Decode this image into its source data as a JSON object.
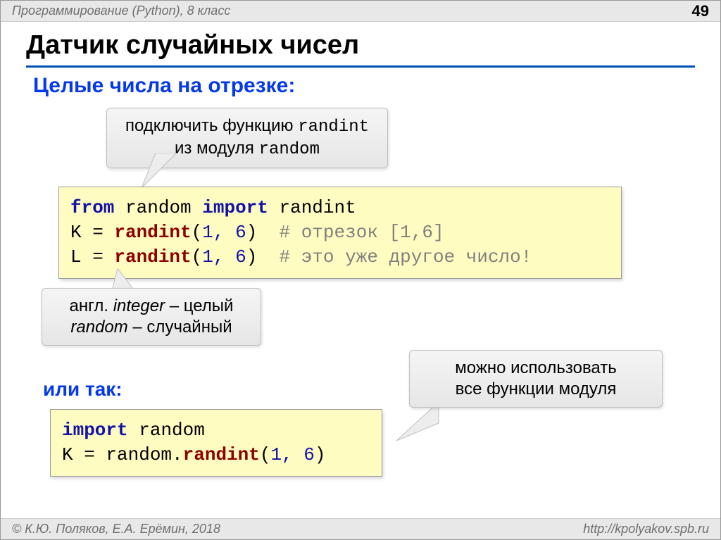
{
  "header": {
    "course": "Программирование (Python), 8 класс",
    "page": "49"
  },
  "title": "Датчик случайных чисел",
  "subtitle": "Целые числа на отрезке:",
  "bubble1": {
    "line1_pre": "подключить функцию ",
    "line1_mono": "randint",
    "line2_pre": "из модуля ",
    "line2_mono": "random"
  },
  "code1": {
    "l1_from": "from",
    "l1_mod": "random",
    "l1_import": "import",
    "l1_name": "randint",
    "l2_var": "K = ",
    "l2_fn": "randint",
    "l2_args_open": "(",
    "l2_a1": "1",
    "l2_comma": ",",
    "l2_a2": "6",
    "l2_close": ")",
    "l2_comment": "  # отрезок [1,6]",
    "l3_var": "L = ",
    "l3_fn": "randint",
    "l3_args_open": "(",
    "l3_a1": "1",
    "l3_comma": ",",
    "l3_a2": "6",
    "l3_close": ")",
    "l3_comment": "  # это уже другое число!"
  },
  "bubble2": {
    "line1_pre": "англ. ",
    "line1_it": "integer",
    "line1_post": " – целый",
    "line2_it": "random",
    "line2_post": " – случайный"
  },
  "or_label": "или так:",
  "code2": {
    "l1_import": "import",
    "l1_mod": "random",
    "l2_var": "K = ",
    "l2_mod": "random.",
    "l2_fn": "randint",
    "l2_open": "(",
    "l2_a1": "1",
    "l2_comma": ",",
    "l2_a2": "6",
    "l2_close": ")"
  },
  "bubble3": {
    "line1": "можно использовать",
    "line2": "все функции модуля"
  },
  "footer": {
    "left": "© К.Ю. Поляков, Е.А. Ерёмин, 2018",
    "right": "http://kpolyakov.spb.ru"
  }
}
